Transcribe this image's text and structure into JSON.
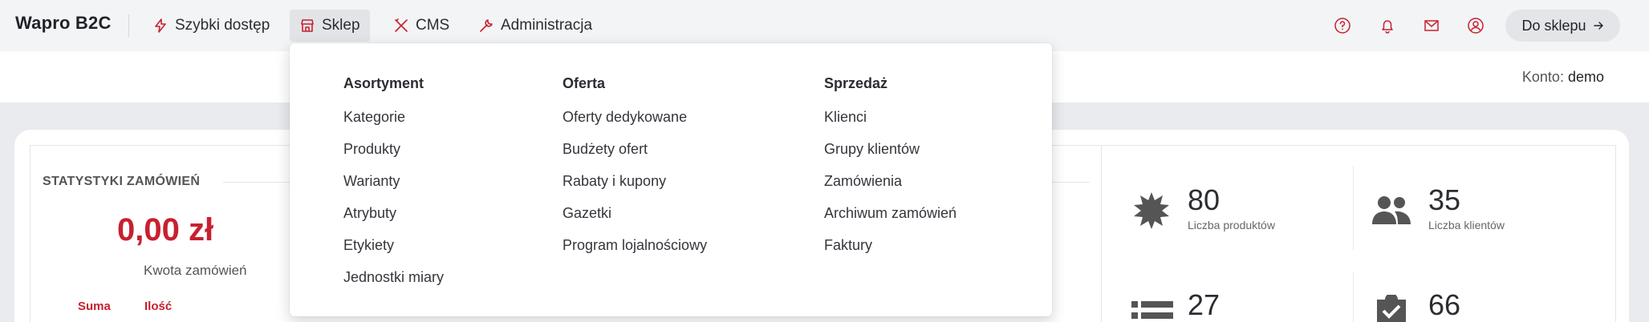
{
  "app": {
    "brand": "Wapro B2C"
  },
  "nav": {
    "items": [
      {
        "label": "Szybki dostęp",
        "icon": "lightning-icon"
      },
      {
        "label": "Sklep",
        "icon": "store-icon",
        "active": true
      },
      {
        "label": "CMS",
        "icon": "tools-icon"
      },
      {
        "label": "Administracja",
        "icon": "wrench-icon"
      }
    ],
    "right_icons": [
      "help-icon",
      "bell-icon",
      "mail-icon",
      "user-icon"
    ],
    "shop_button": "Do sklepu"
  },
  "account": {
    "label": "Konto:",
    "value": "demo"
  },
  "dropdown": {
    "columns": [
      {
        "title": "Asortyment",
        "items": [
          "Kategorie",
          "Produkty",
          "Warianty",
          "Atrybuty",
          "Etykiety",
          "Jednostki miary"
        ]
      },
      {
        "title": "Oferta",
        "items": [
          "Oferty dedykowane",
          "Budżety ofert",
          "Rabaty i kupony",
          "Gazetki",
          "Program lojalnościowy"
        ]
      },
      {
        "title": "Sprzedaż",
        "items": [
          "Klienci",
          "Grupy klientów",
          "Zamówienia",
          "Archiwum zamówień",
          "Faktury"
        ]
      }
    ]
  },
  "stats_card": {
    "title": "STATYSTYKI ZAMÓWIEŃ",
    "amount": "0,00 zł",
    "amount_label": "Kwota zamówień",
    "tabs": [
      "Suma",
      "Ilość"
    ]
  },
  "summary": {
    "products": {
      "value": "80",
      "label": "Liczba produktów"
    },
    "clients": {
      "value": "35",
      "label": "Liczba klientów"
    },
    "third": {
      "value": "27"
    },
    "fourth": {
      "value": "66"
    }
  },
  "colors": {
    "accent": "#c8202f",
    "topbar": "#f3f4f6",
    "background": "#e9ebee"
  }
}
